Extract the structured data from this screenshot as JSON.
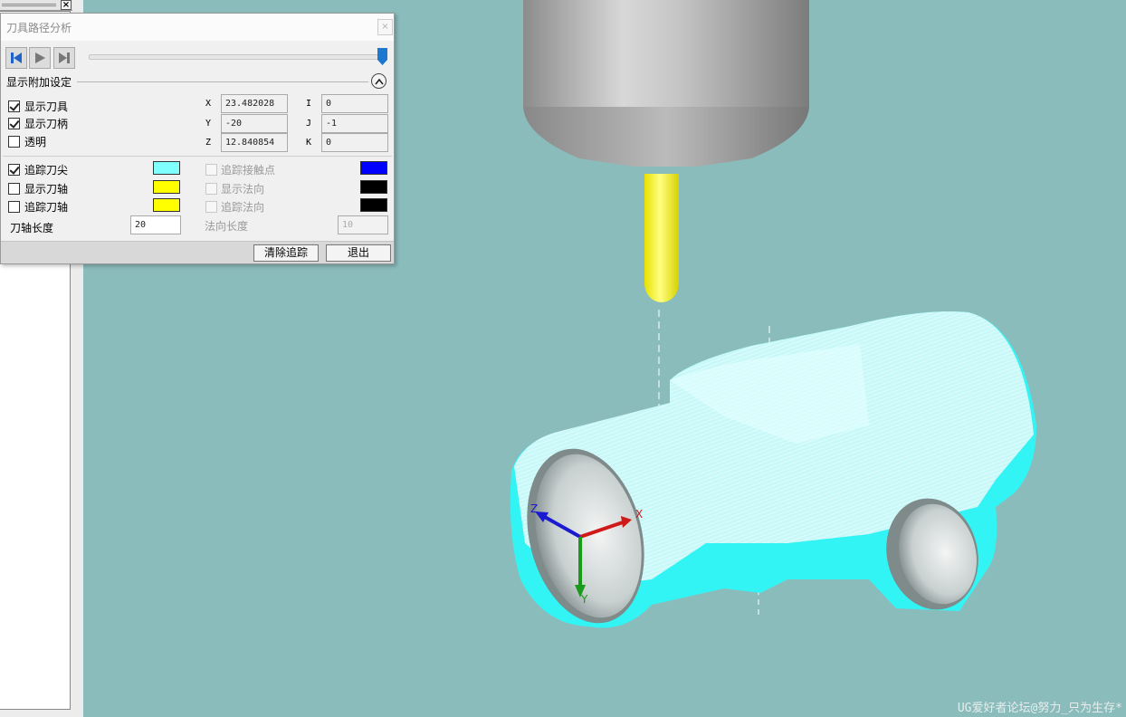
{
  "left_panel": {
    "close_glyph": "×"
  },
  "dialog": {
    "title": "刀具路径分析",
    "close_glyph": "×",
    "playback": {
      "rewind_icon": "skip-to-start-icon",
      "play_icon": "play-icon",
      "end_icon": "skip-to-end-icon",
      "slider_value": 1.0
    },
    "section_title": "显示附加设定",
    "options": [
      {
        "label": "显示刀具",
        "checked": true
      },
      {
        "label": "显示刀柄",
        "checked": true
      },
      {
        "label": "透明",
        "checked": false
      }
    ],
    "coords": [
      {
        "axis": "X",
        "value": "23.482028"
      },
      {
        "axis": "Y",
        "value": "-20"
      },
      {
        "axis": "Z",
        "value": "12.840854"
      }
    ],
    "vectors": [
      {
        "axis": "I",
        "value": "0"
      },
      {
        "axis": "J",
        "value": "-1"
      },
      {
        "axis": "K",
        "value": "0"
      }
    ],
    "trace_left": [
      {
        "label": "追踪刀尖",
        "checked": true,
        "color": "#80ffff"
      },
      {
        "label": "显示刀轴",
        "checked": false,
        "color": "#ffff00"
      },
      {
        "label": "追踪刀轴",
        "checked": false,
        "color": "#ffff00"
      }
    ],
    "trace_right": [
      {
        "label": "追踪接触点",
        "checked": false,
        "color": "#0000ff"
      },
      {
        "label": "显示法向",
        "checked": false,
        "color": "#000000"
      },
      {
        "label": "追踪法向",
        "checked": false,
        "color": "#000000"
      }
    ],
    "axis_length": {
      "label": "刀轴长度",
      "value": "20"
    },
    "normal_length": {
      "label": "法向长度",
      "value": "10"
    },
    "buttons": {
      "clear": "清除追踪",
      "exit": "退出"
    }
  },
  "viewport": {
    "background": "#8bbcbc",
    "triad": {
      "x_label": "X",
      "y_label": "Y",
      "z_label": "Z"
    },
    "watermark": "UG爱好者论坛@努力_只为生存*"
  }
}
